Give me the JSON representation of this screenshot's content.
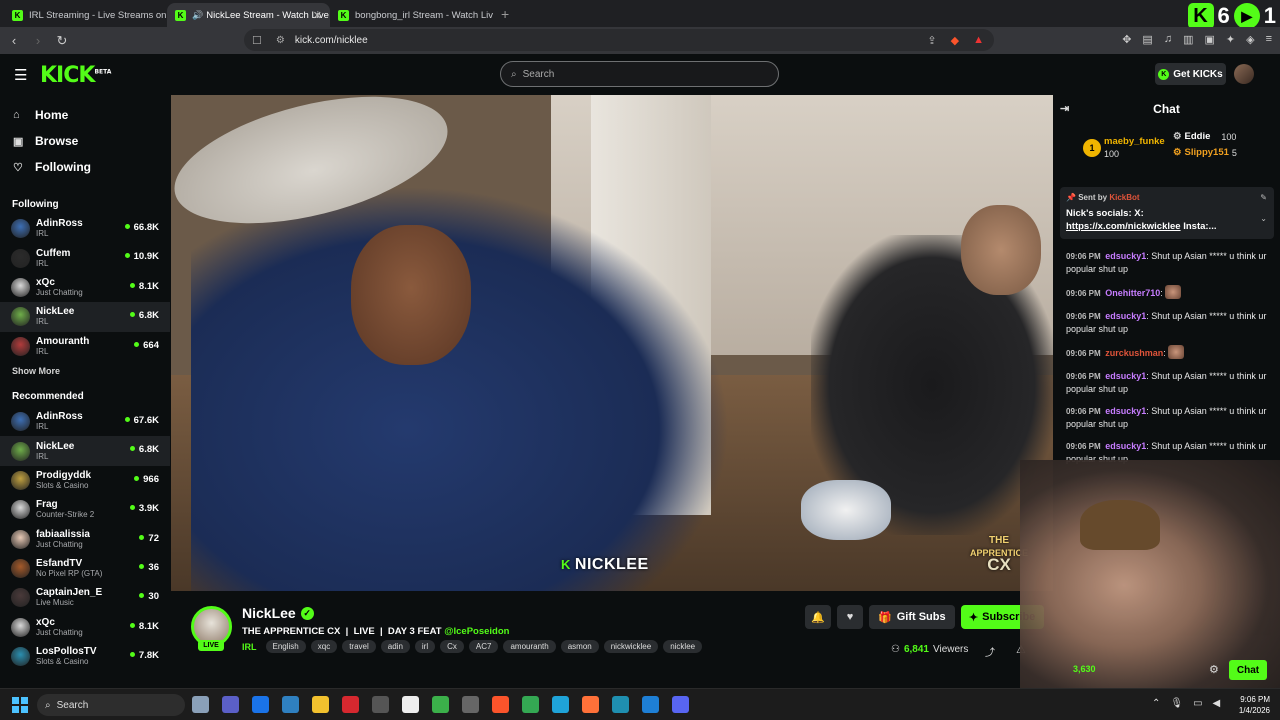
{
  "browser": {
    "tabs": [
      {
        "title": "IRL Streaming - Live Streams on Kick",
        "active": false,
        "audio": false
      },
      {
        "title": "NickLee Stream - Watch Live on Kick",
        "active": true,
        "audio": true
      },
      {
        "title": "bongbong_irl Stream - Watch Live on Kick",
        "active": false,
        "audio": false
      }
    ],
    "new_tab": "+",
    "url": "kick.com/nicklee",
    "corner_badge": {
      "k_count": "6",
      "play_count": "1"
    }
  },
  "header": {
    "logo": "KICK",
    "logo_beta": "BETA",
    "search_placeholder": "Search",
    "get_kicks": "Get KICKs"
  },
  "sidebar": {
    "nav": [
      {
        "label": "Home",
        "icon": "home-icon"
      },
      {
        "label": "Browse",
        "icon": "browse-icon"
      },
      {
        "label": "Following",
        "icon": "heart-icon"
      }
    ],
    "following_title": "Following",
    "following": [
      {
        "name": "AdinRoss",
        "category": "IRL",
        "viewers": "66.8K",
        "color": "#3d6fb5"
      },
      {
        "name": "Cuffem",
        "category": "IRL",
        "viewers": "10.9K",
        "color": "#2b2b2b"
      },
      {
        "name": "xQc",
        "category": "Just Chatting",
        "viewers": "8.1K",
        "color": "#d9d9d9"
      },
      {
        "name": "NickLee",
        "category": "IRL",
        "viewers": "6.8K",
        "color": "#6fae4a",
        "selected": true
      },
      {
        "name": "Amouranth",
        "category": "IRL",
        "viewers": "664",
        "color": "#b23c3c"
      }
    ],
    "show_more": "Show More",
    "recommended_title": "Recommended",
    "recommended": [
      {
        "name": "AdinRoss",
        "category": "IRL",
        "viewers": "67.6K",
        "color": "#3d6fb5"
      },
      {
        "name": "NickLee",
        "category": "IRL",
        "viewers": "6.8K",
        "color": "#6fae4a",
        "selected": true
      },
      {
        "name": "Prodigyddk",
        "category": "Slots & Casino",
        "viewers": "966",
        "color": "#c0a040"
      },
      {
        "name": "Frag",
        "category": "Counter-Strike 2",
        "viewers": "3.9K",
        "color": "#d9d9d9"
      },
      {
        "name": "fabiaalissia",
        "category": "Just Chatting",
        "viewers": "72",
        "color": "#e8c9b5"
      },
      {
        "name": "EsfandTV",
        "category": "No Pixel RP (GTA)",
        "viewers": "36",
        "color": "#a55a2a"
      },
      {
        "name": "CaptainJen_E",
        "category": "Live Music",
        "viewers": "30",
        "color": "#4a3a3a"
      },
      {
        "name": "xQc",
        "category": "Just Chatting",
        "viewers": "8.1K",
        "color": "#d9d9d9"
      },
      {
        "name": "LosPollosTV",
        "category": "Slots & Casino",
        "viewers": "7.8K",
        "color": "#2b8fb0"
      }
    ]
  },
  "video": {
    "watermark": "NICKLEE",
    "overlay_line1": "THE",
    "overlay_line2": "APPRENTICE",
    "overlay_line3": "CX"
  },
  "stream": {
    "name": "NickLee",
    "live_badge": "LIVE",
    "title": "THE APPRENTICE CX  |  LIVE  |  DAY 3 FEAT",
    "mention": "@IcePoseidon",
    "category": "IRL",
    "tags": [
      "English",
      "xqc",
      "travel",
      "adin",
      "irl",
      "Cx",
      "AC7",
      "amouranth",
      "asmon",
      "nickwicklee",
      "nicklee"
    ],
    "gift_subs": "Gift Subs",
    "subscribe": "Subscribe",
    "viewers": "6,841",
    "viewers_label": "Viewers"
  },
  "chat": {
    "title": "Chat",
    "top_gifters": [
      {
        "rank": "1",
        "name": "maeby_funke",
        "amount": "100",
        "color": "#f0b400"
      },
      {
        "name": "Eddie",
        "amount": "100",
        "color": "#ffffff"
      },
      {
        "name": "Slippy151",
        "amount": "5",
        "color": "#f0a020"
      }
    ],
    "pinned": {
      "sent_by": "Sent by",
      "bot": "KickBot",
      "text": "Nick's socials: X:",
      "link": "https://x.com/nickwicklee",
      "rest": "Insta:..."
    },
    "messages": [
      {
        "time": "09:06 PM",
        "user": "edsucky1",
        "color": "#c77dff",
        "text": "Shut up Asian ***** u think ur popular shut up"
      },
      {
        "time": "09:06 PM",
        "user": "Onehitter710",
        "color": "#c77dff",
        "text": "",
        "emote": true
      },
      {
        "time": "09:06 PM",
        "user": "edsucky1",
        "color": "#c77dff",
        "text": "Shut up Asian ***** u think ur popular shut up"
      },
      {
        "time": "09:06 PM",
        "user": "zurckushman",
        "color": "#e0543a",
        "text": "",
        "emote": true
      },
      {
        "time": "09:06 PM",
        "user": "edsucky1",
        "color": "#c77dff",
        "text": "Shut up Asian ***** u think ur popular shut up"
      },
      {
        "time": "09:06 PM",
        "user": "edsucky1",
        "color": "#c77dff",
        "text": "Shut up Asian ***** u think ur popular shut up"
      },
      {
        "time": "09:06 PM",
        "user": "edsucky1",
        "color": "#c77dff",
        "text": "Shut up Asian ***** u think ur popular shut up"
      }
    ],
    "points": "3,630",
    "chat_button": "Chat"
  },
  "taskbar": {
    "search": "Search",
    "time": "9:06 PM",
    "date": "1/4/2026"
  }
}
